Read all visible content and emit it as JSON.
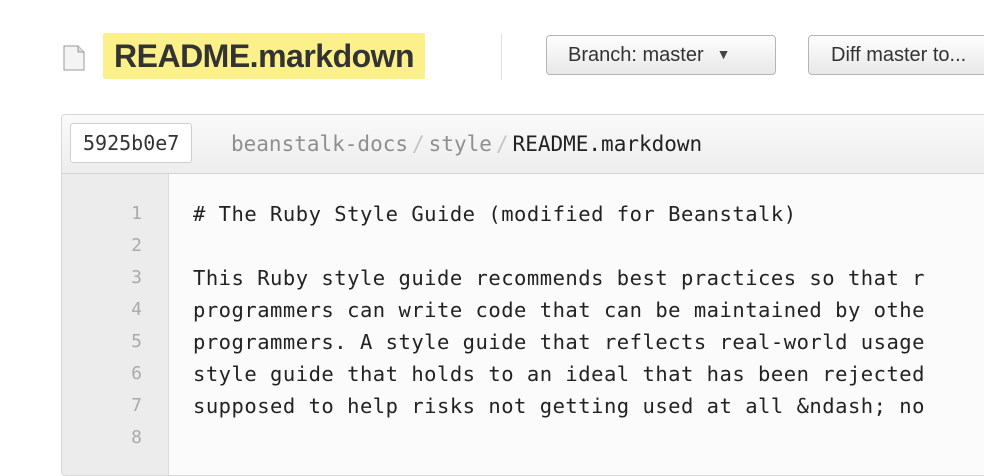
{
  "header": {
    "filename": "README.markdown",
    "branch_button": "Branch: master",
    "diff_button": "Diff master to..."
  },
  "path_bar": {
    "commit": "5925b0e7",
    "crumbs": [
      "beanstalk-docs",
      "style"
    ],
    "current": "README.markdown",
    "separator": "/"
  },
  "code": {
    "line_numbers": [
      "1",
      "2",
      "3",
      "4",
      "5",
      "6",
      "7",
      "8"
    ],
    "lines": [
      "# The Ruby Style Guide (modified for Beanstalk)",
      "",
      "This Ruby style guide recommends best practices so that r",
      "programmers can write code that can be maintained by othe",
      "programmers. A style guide that reflects real-world usage",
      "style guide that holds to an ideal that has been rejected",
      "supposed to help risks not getting used at all &ndash; no",
      ""
    ]
  }
}
